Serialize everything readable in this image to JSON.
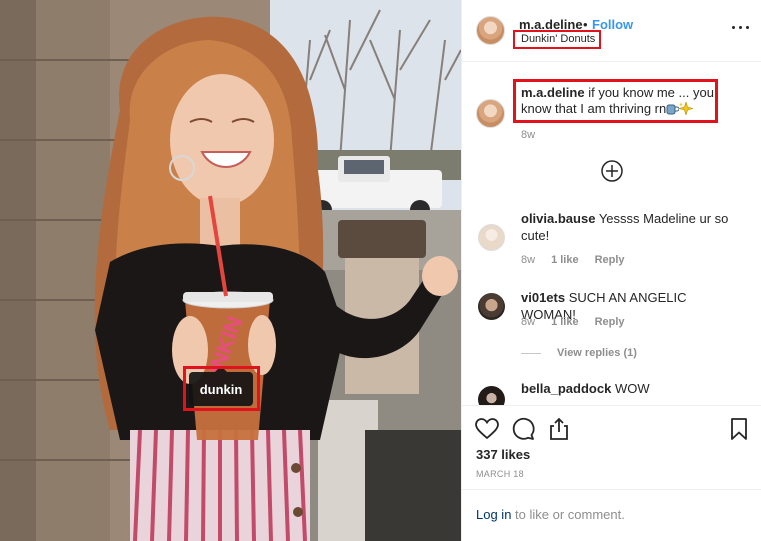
{
  "photo": {
    "tag_label": "dunkin",
    "cup_text": "DUNKIN"
  },
  "header": {
    "username": "m.a.deline",
    "separator": "•",
    "follow_label": "Follow",
    "location": "Dunkin' Donuts",
    "more_icon": "more-options-icon"
  },
  "caption": {
    "username": "m.a.deline",
    "text": "if you know me ... you know that I am thriving rn",
    "emojis": [
      "coffee-emoji",
      "sparkles-emoji"
    ],
    "time": "8w"
  },
  "load_more_icon": "plus-circle-icon",
  "comments": [
    {
      "username": "olivia.bause",
      "text": "Yessss Madeline ur so cute!",
      "time": "8w",
      "likes": "1 like",
      "reply": "Reply"
    },
    {
      "username": "vi01ets",
      "text": "SUCH AN ANGELIC WOMAN!",
      "time": "8w",
      "likes": "1 like",
      "reply": "Reply"
    },
    {
      "username": "bella_paddock",
      "text": "WOW"
    }
  ],
  "view_replies": "View replies (1)",
  "actions": {
    "like_icon": "heart-icon",
    "comment_icon": "comment-icon",
    "share_icon": "share-icon",
    "save_icon": "bookmark-icon"
  },
  "likes_count": "337 likes",
  "date": "MARCH 18",
  "login": {
    "link": "Log in",
    "rest": "to like or comment."
  },
  "colors": {
    "follow": "#3897f0",
    "highlight": "#e0121b",
    "login_link": "#003569"
  }
}
